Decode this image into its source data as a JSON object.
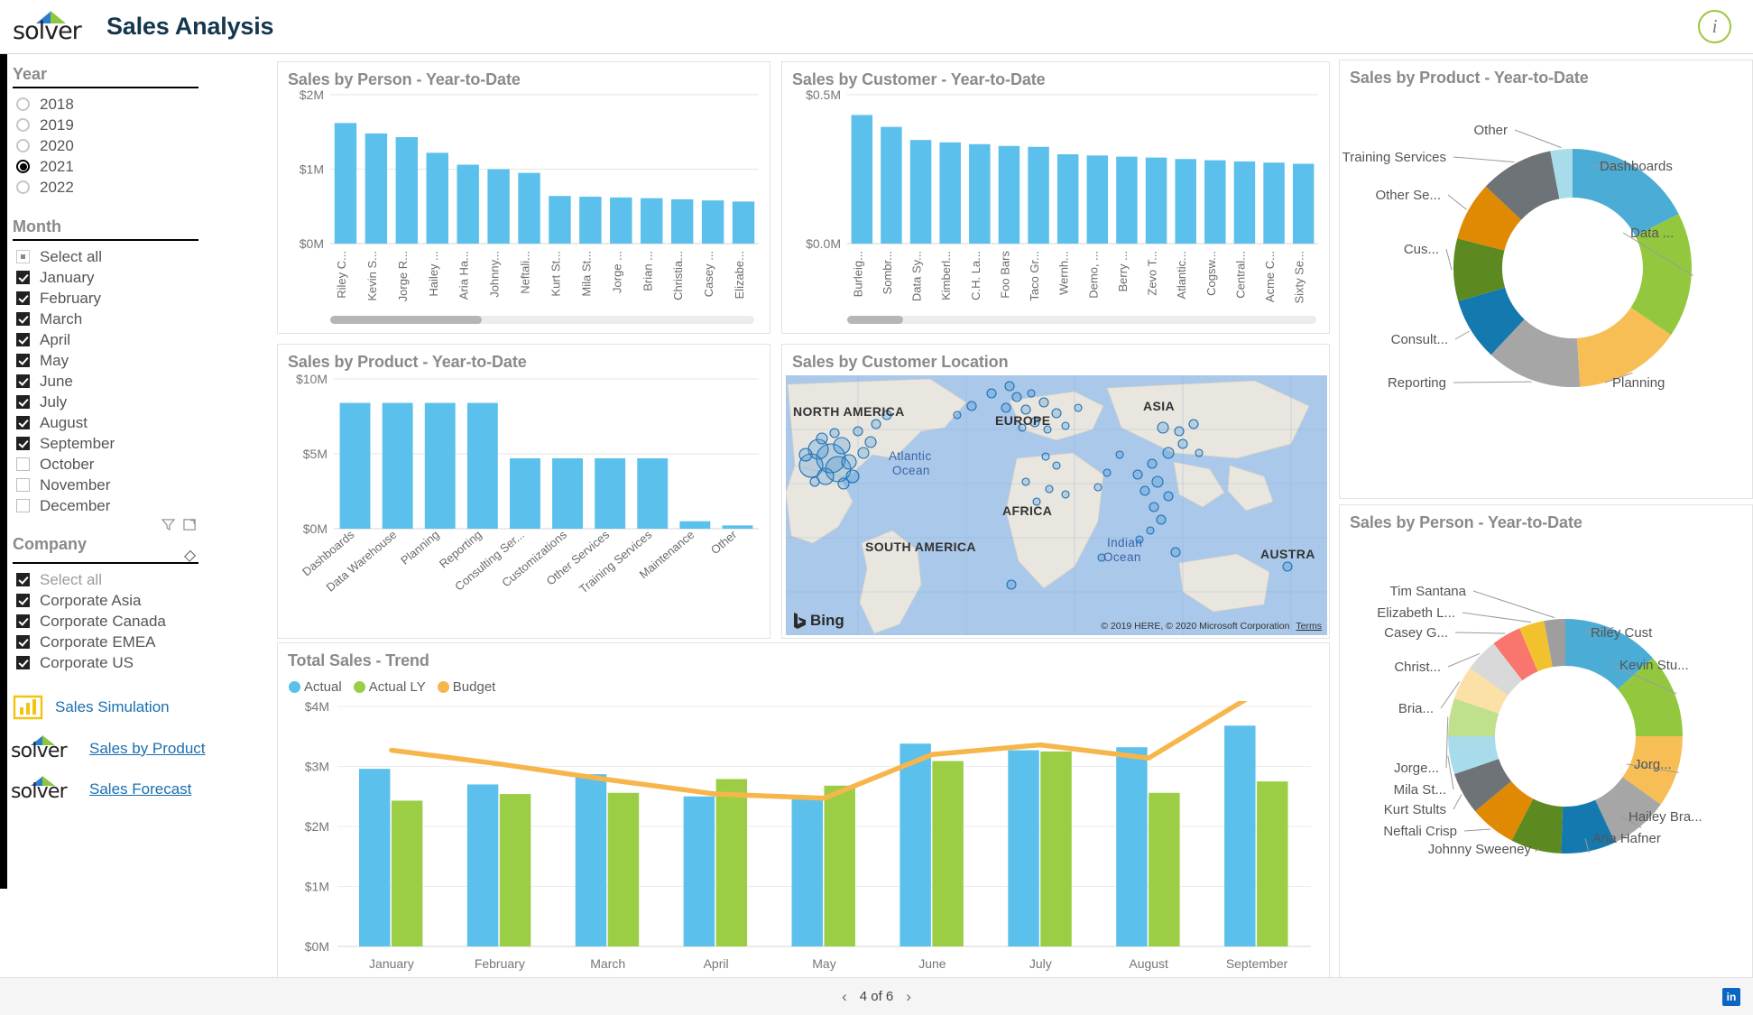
{
  "header": {
    "logo_text": "solver",
    "title": "Sales Analysis",
    "info_label": "i"
  },
  "sidebar": {
    "year_slicer": {
      "title": "Year",
      "options": [
        {
          "label": "2018",
          "selected": false
        },
        {
          "label": "2019",
          "selected": false
        },
        {
          "label": "2020",
          "selected": false
        },
        {
          "label": "2021",
          "selected": true
        },
        {
          "label": "2022",
          "selected": false
        }
      ]
    },
    "month_slicer": {
      "title": "Month",
      "options": [
        {
          "label": "Select all",
          "state": "partial"
        },
        {
          "label": "January",
          "state": "on"
        },
        {
          "label": "February",
          "state": "on"
        },
        {
          "label": "March",
          "state": "on"
        },
        {
          "label": "April",
          "state": "on"
        },
        {
          "label": "May",
          "state": "on"
        },
        {
          "label": "June",
          "state": "on"
        },
        {
          "label": "July",
          "state": "on"
        },
        {
          "label": "August",
          "state": "on"
        },
        {
          "label": "September",
          "state": "on"
        },
        {
          "label": "October",
          "state": "off"
        },
        {
          "label": "November",
          "state": "off"
        },
        {
          "label": "December",
          "state": "off"
        }
      ]
    },
    "company_slicer": {
      "title": "Company",
      "options": [
        {
          "label": "Select all",
          "state": "on"
        },
        {
          "label": "Corporate Asia",
          "state": "on"
        },
        {
          "label": "Corporate Canada",
          "state": "on"
        },
        {
          "label": "Corporate EMEA",
          "state": "on"
        },
        {
          "label": "Corporate US",
          "state": "on"
        }
      ]
    },
    "links": [
      {
        "label": "Sales Simulation",
        "icon": "power-bi-icon",
        "underline": false
      },
      {
        "label": "Sales by Product",
        "icon": "solver-logo-icon",
        "underline": true
      },
      {
        "label": "Sales Forecast",
        "icon": "solver-logo-icon",
        "underline": true
      }
    ]
  },
  "panels": {
    "sales_by_person_bar": {
      "title": "Sales by Person  - Year-to-Date"
    },
    "sales_by_customer_bar": {
      "title": "Sales by Customer - Year-to-Date"
    },
    "sales_by_product_bar": {
      "title": "Sales by Product - Year-to-Date"
    },
    "sales_by_customer_location": {
      "title": "Sales by Customer Location"
    },
    "sales_by_product_donut": {
      "title": "Sales by Product - Year-to-Date"
    },
    "sales_by_person_donut": {
      "title": "Sales by Person  - Year-to-Date"
    },
    "total_sales_trend": {
      "title": "Total Sales - Trend"
    }
  },
  "map": {
    "labels": [
      {
        "text": "NORTH AMERICA",
        "kind": "continent"
      },
      {
        "text": "EUROPE",
        "kind": "continent"
      },
      {
        "text": "ASIA",
        "kind": "continent"
      },
      {
        "text": "AFRICA",
        "kind": "continent"
      },
      {
        "text": "SOUTH AMERICA",
        "kind": "continent"
      },
      {
        "text": "AUSTRA",
        "kind": "continent"
      },
      {
        "text": "Atlantic",
        "kind": "ocean"
      },
      {
        "text": "Ocean",
        "kind": "ocean"
      },
      {
        "text": "Indian",
        "kind": "ocean"
      },
      {
        "text": "Ocean",
        "kind": "ocean"
      }
    ],
    "provider": "Bing",
    "credit": "© 2019 HERE, © 2020 Microsoft Corporation",
    "terms_label": "Terms"
  },
  "footer": {
    "page_label": "4 of 6",
    "prev_arrow": "‹",
    "next_arrow": "›",
    "linkedin_label": "in"
  },
  "chart_data": [
    {
      "id": "sales-by-person-bar",
      "type": "bar",
      "title": "Sales by Person  - Year-to-Date",
      "xlabel": "",
      "ylabel": "",
      "ylim": [
        0,
        2000000
      ],
      "ytick_labels": [
        "$0M",
        "$1M",
        "$2M"
      ],
      "ytick_values": [
        0,
        1000000,
        2000000
      ],
      "grid": true,
      "bar_color": "#5BC0EB",
      "categories": [
        "Riley C...",
        "Kevin S...",
        "Jorge R...",
        "Hailey ...",
        "Aria Ha...",
        "Johnny...",
        "Neftali...",
        "Kurt St...",
        "Mila St...",
        "Jorge ...",
        "Brian ...",
        "Christia...",
        "Casey ...",
        "Elizabe..."
      ],
      "values": [
        1620000,
        1480000,
        1430000,
        1220000,
        1060000,
        1000000,
        950000,
        640000,
        630000,
        620000,
        610000,
        595000,
        580000,
        565000
      ],
      "has_scrollbar": true
    },
    {
      "id": "sales-by-customer-bar",
      "type": "bar",
      "title": "Sales by Customer - Year-to-Date",
      "xlabel": "",
      "ylabel": "",
      "ylim": [
        0,
        500000
      ],
      "ytick_labels": [
        "$0.0M",
        "$0.5M"
      ],
      "ytick_values": [
        0,
        500000
      ],
      "grid": true,
      "bar_color": "#5BC0EB",
      "categories": [
        "Burleig...",
        "Sombr...",
        "Data Sy...",
        "Kimberl...",
        "C.H. La...",
        "Foo Bars",
        "Taco Gr...",
        "Wernh...",
        "Demo, ...",
        "Berry ...",
        "Zevo T...",
        "Atlantic...",
        "Cogsw...",
        "Central...",
        "Acme C...",
        "Sixty Se..."
      ],
      "values": [
        432000,
        392000,
        348000,
        340000,
        334000,
        328000,
        325000,
        300000,
        296000,
        292000,
        289000,
        284000,
        280000,
        276000,
        272000,
        268000
      ],
      "has_scrollbar": true
    },
    {
      "id": "sales-by-product-bar",
      "type": "bar",
      "title": "Sales by Product - Year-to-Date",
      "xlabel": "",
      "ylabel": "",
      "ylim": [
        0,
        10000000
      ],
      "ytick_labels": [
        "$0M",
        "$5M",
        "$10M"
      ],
      "ytick_values": [
        0,
        5000000,
        10000000
      ],
      "grid": true,
      "bar_color": "#5BC0EB",
      "categories": [
        "Dashboards",
        "Data Warehouse",
        "Planning",
        "Reporting",
        "Consulting Ser...",
        "Customizations",
        "Other Services",
        "Training Services",
        "Maintenance",
        "Other"
      ],
      "values": [
        8400000,
        8400000,
        8400000,
        8400000,
        4700000,
        4700000,
        4700000,
        4700000,
        500000,
        220000
      ]
    },
    {
      "id": "sales-by-product-donut",
      "type": "pie",
      "title": "Sales by Product - Year-to-Date",
      "labels": [
        "Dashboards",
        "Data ...",
        "Planning",
        "Reporting",
        "Consult...",
        "Cus...",
        "Other Se...",
        "Training Services",
        "Other"
      ],
      "values": [
        17.5,
        17.0,
        14.5,
        13.0,
        8.5,
        8.5,
        8.0,
        10.0,
        3.0
      ],
      "colors": [
        "#4BACD6",
        "#93C83E",
        "#F7BE56",
        "#A6A6A6",
        "#1479AE",
        "#5C8A21",
        "#E08A03",
        "#6E7377",
        "#A8DCEA"
      ],
      "legend_position": "callout"
    },
    {
      "id": "sales-by-person-donut",
      "type": "pie",
      "title": "Sales by Person  - Year-to-Date",
      "labels": [
        "Riley Cust",
        "Kevin Stu...",
        "Jorg...",
        "Hailey Bra...",
        "Aria Hafner",
        "Johnny Sweeney",
        "Neftali Crisp",
        "Kurt Stults",
        "Mila St...",
        "Jorge...",
        "Bria...",
        "Christ...",
        "Casey G...",
        "Elizabeth L...",
        "Tim Santana"
      ],
      "values": [
        11.5,
        10.0,
        8.5,
        7.0,
        6.5,
        6.0,
        5.5,
        5.0,
        4.5,
        4.5,
        4.0,
        4.0,
        3.5,
        3.0,
        2.5
      ],
      "colors": [
        "#4BACD6",
        "#93C83E",
        "#F7BE56",
        "#A6A6A6",
        "#1479AE",
        "#5C8A21",
        "#E08A03",
        "#6E7377",
        "#A8DCEA",
        "#BFE08C",
        "#FBE0A8",
        "#D9D9D9",
        "#F8766D",
        "#F2C12E",
        "#9E9E9E"
      ],
      "legend_position": "callout"
    },
    {
      "id": "total-sales-trend",
      "type": "bar",
      "title": "Total Sales - Trend",
      "xlabel": "",
      "ylabel": "",
      "ylim": [
        0,
        4000000
      ],
      "ytick_labels": [
        "$0M",
        "$1M",
        "$2M",
        "$3M",
        "$4M"
      ],
      "ytick_values": [
        0,
        1000000,
        2000000,
        3000000,
        4000000
      ],
      "grid": true,
      "categories": [
        "January",
        "February",
        "March",
        "April",
        "May",
        "June",
        "July",
        "August",
        "September"
      ],
      "legend": [
        "Actual",
        "Actual LY",
        "Budget"
      ],
      "legend_colors": [
        "#5BC0EB",
        "#9BCE44",
        "#F7B64C"
      ],
      "series": [
        {
          "name": "Actual",
          "kind": "bar",
          "color": "#5BC0EB",
          "values": [
            2960000,
            2700000,
            2870000,
            2500000,
            2450000,
            3380000,
            3270000,
            3320000,
            3680000
          ]
        },
        {
          "name": "Actual LY",
          "kind": "bar",
          "color": "#9BCE44",
          "values": [
            2430000,
            2540000,
            2560000,
            2790000,
            2680000,
            3090000,
            3250000,
            2560000,
            2750000
          ]
        },
        {
          "name": "Budget",
          "kind": "line",
          "color": "#F7B64C",
          "values": [
            3270000,
            3040000,
            2780000,
            2540000,
            2470000,
            3200000,
            3360000,
            3140000,
            4230000
          ]
        }
      ]
    }
  ]
}
